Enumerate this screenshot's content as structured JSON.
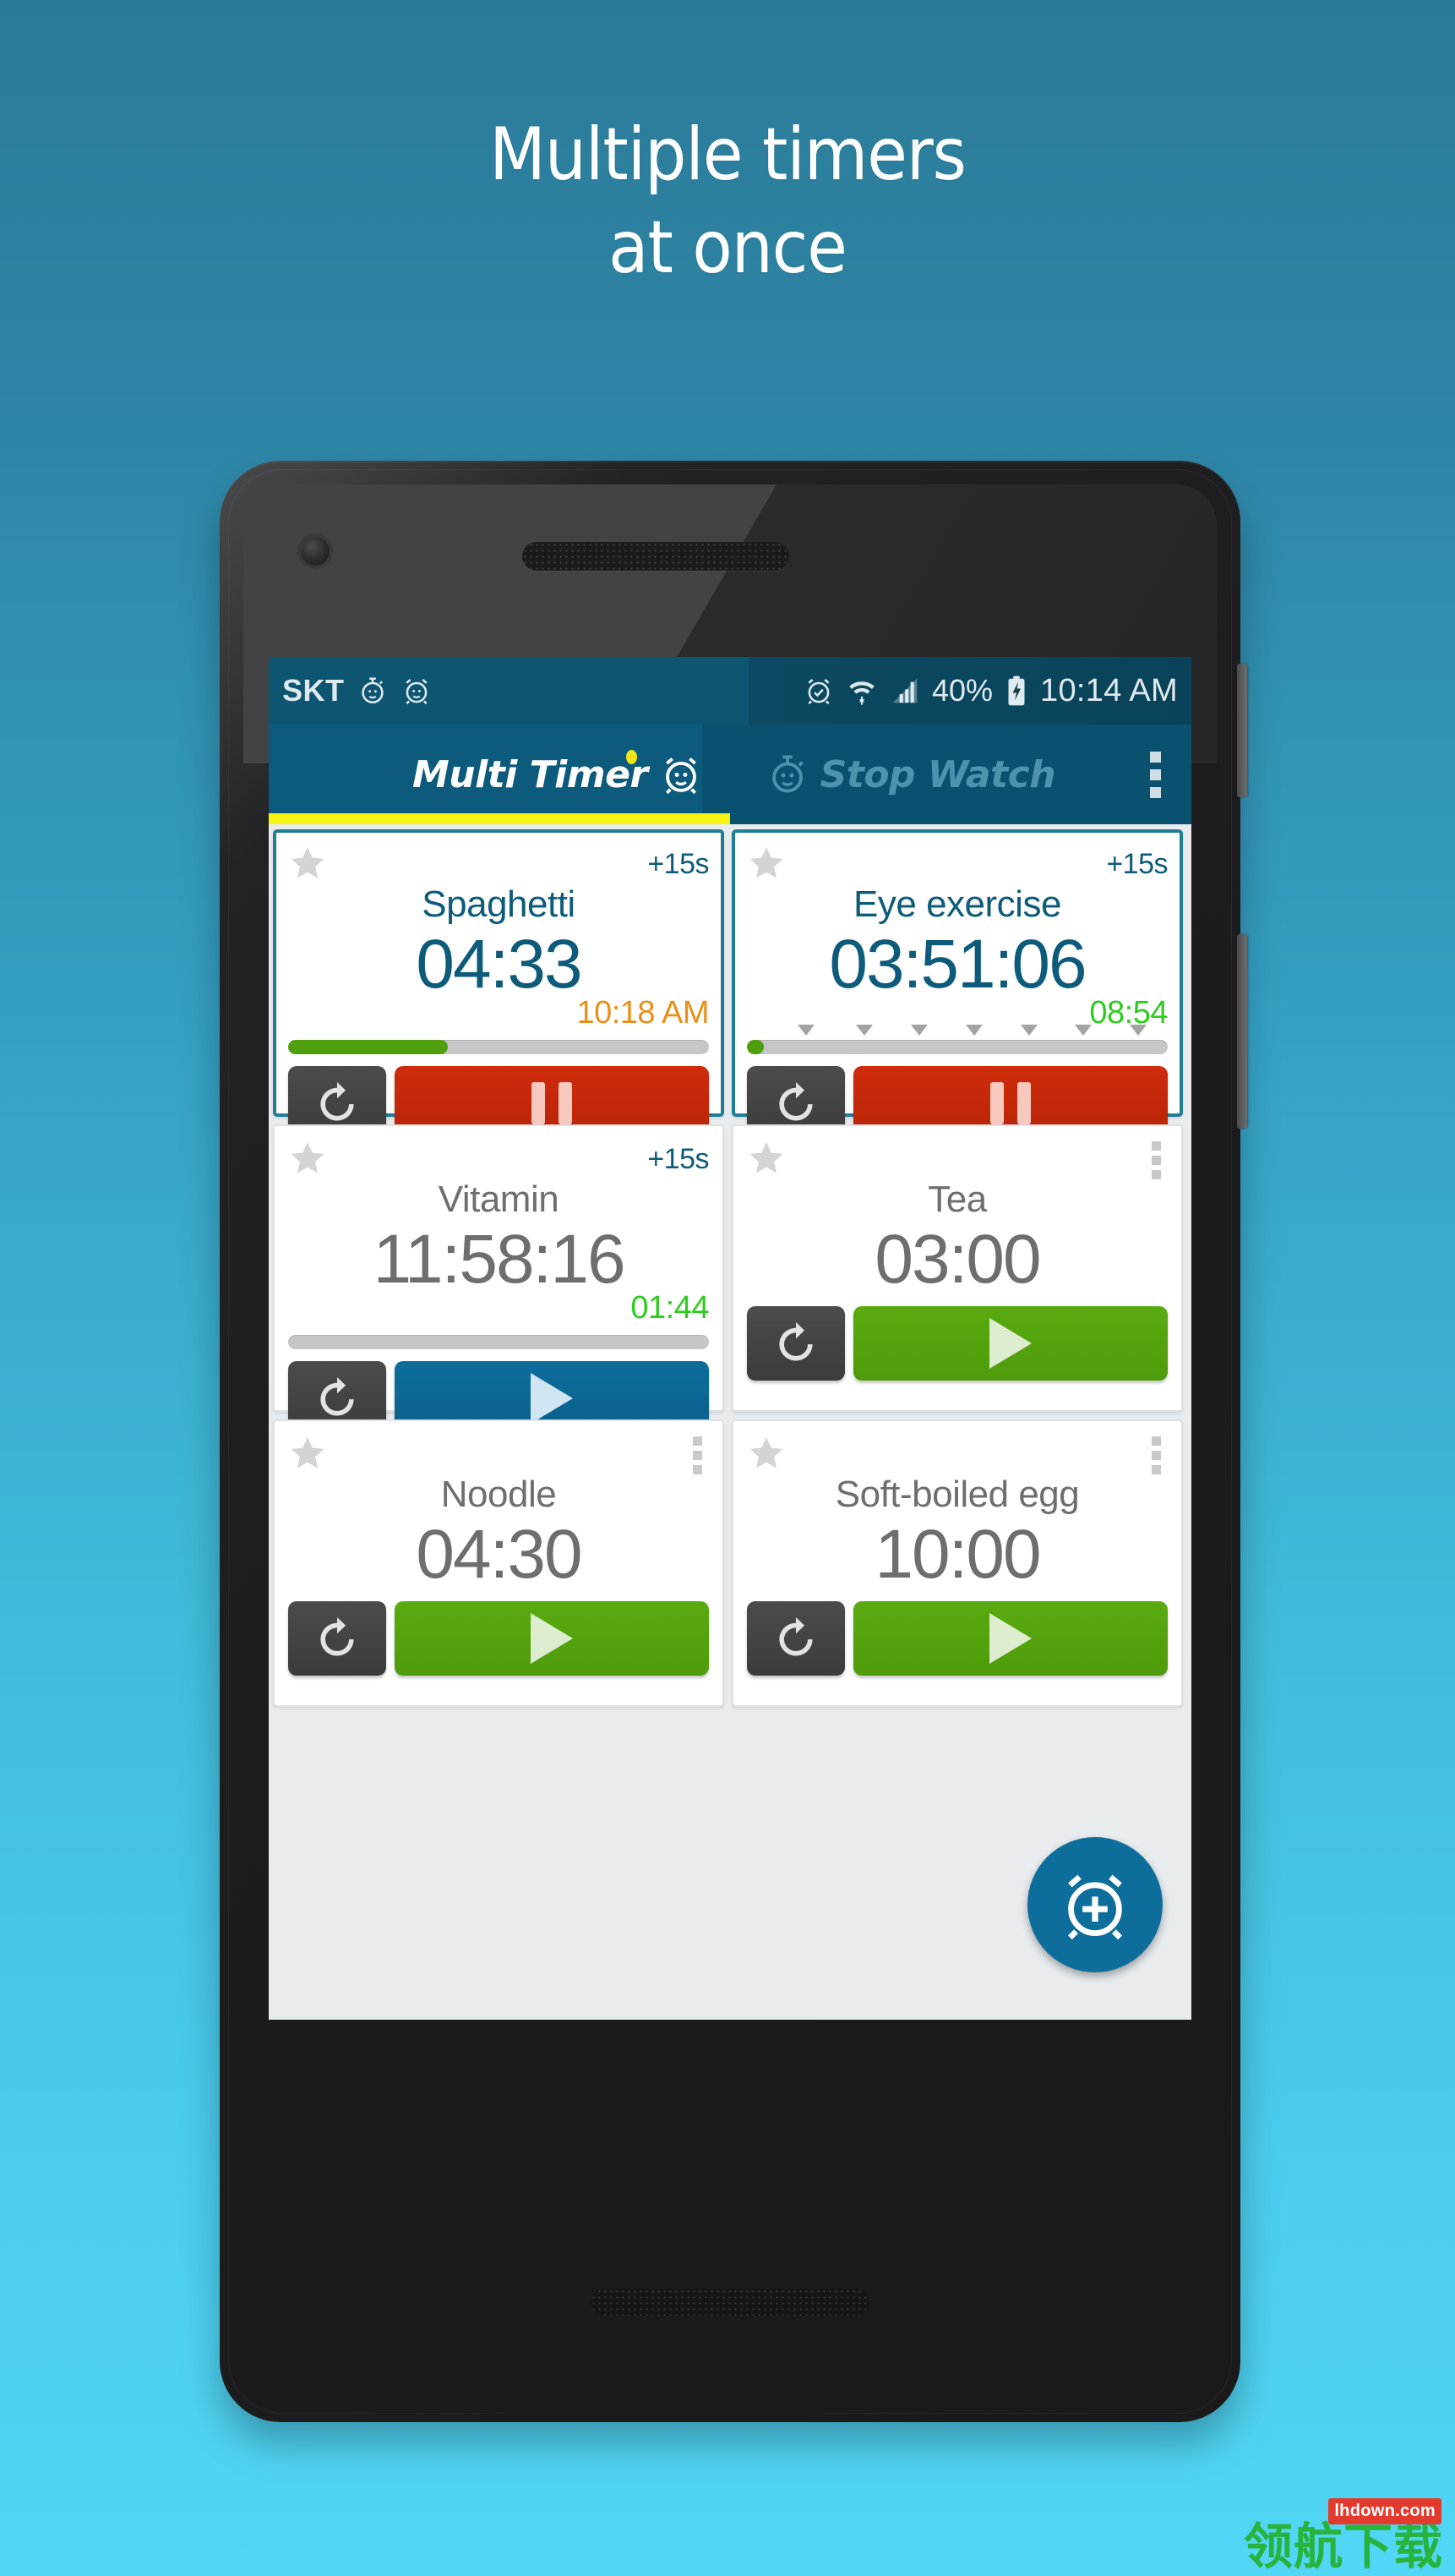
{
  "promo": {
    "line1": "Multiple timers",
    "line2": "at once"
  },
  "status_bar": {
    "carrier": "SKT",
    "battery_percent": "40%",
    "clock": "10:14 AM",
    "icons": [
      "stopwatch-icon",
      "alarm-icon",
      "alarm-set-icon",
      "wifi-icon",
      "cellular-signal-icon",
      "battery-charging-icon"
    ]
  },
  "appbar": {
    "tabs": [
      {
        "label": "Multi Timer",
        "icon": "alarm-clock-icon",
        "active": true
      },
      {
        "label": "Stop Watch",
        "icon": "stopwatch-icon",
        "active": false
      }
    ],
    "overflow_menu": "overflow-menu-icon"
  },
  "colors": {
    "accent_teal": "#0d5b7a",
    "appbar_bg": "#0c5b7c",
    "tab_underline": "#f7f413",
    "running_border": "#1f7d95",
    "progress_green": "#4e9e0e",
    "pause_red": "#cf2c0c",
    "play_green": "#59ab10",
    "play_blue": "#0d6e9c",
    "idle_text": "#6e6e6e",
    "amber": "#e8901a",
    "bright_green": "#2ecc1f",
    "fab_blue": "#0d6e9c"
  },
  "timers": [
    {
      "name": "Spaghetti",
      "time": "04:33",
      "sub": "10:18 AM",
      "sub_color": "amber",
      "state": "running",
      "top_right": "+15s",
      "progress_percent": 38,
      "has_ticks": false,
      "main_action": "pause"
    },
    {
      "name": "Eye exercise",
      "time": "03:51:06",
      "sub": "08:54",
      "sub_color": "green",
      "state": "running",
      "top_right": "+15s",
      "progress_percent": 4,
      "has_ticks": true,
      "tick_positions": [
        14,
        28,
        41,
        54,
        67,
        80,
        93
      ],
      "main_action": "pause"
    },
    {
      "name": "Vitamin",
      "time": "11:58:16",
      "sub": "01:44",
      "sub_color": "green",
      "state": "idle",
      "top_right": "+15s",
      "progress_percent": 0,
      "has_ticks": false,
      "main_action": "play-blue"
    },
    {
      "name": "Tea",
      "time": "03:00",
      "sub": "",
      "sub_color": "",
      "state": "idle",
      "top_right": "menu",
      "progress_percent": null,
      "has_ticks": false,
      "main_action": "play-green"
    },
    {
      "name": "Noodle",
      "time": "04:30",
      "sub": "",
      "sub_color": "",
      "state": "idle",
      "top_right": "menu",
      "progress_percent": null,
      "has_ticks": false,
      "main_action": "play-green"
    },
    {
      "name": "Soft-boiled egg",
      "time": "10:00",
      "sub": "",
      "sub_color": "",
      "state": "idle",
      "top_right": "menu",
      "progress_percent": null,
      "has_ticks": false,
      "main_action": "play-green"
    }
  ],
  "fab": {
    "icon": "add-alarm-icon"
  },
  "watermark": {
    "text": "领航下载",
    "badge": "lhdown.com"
  }
}
